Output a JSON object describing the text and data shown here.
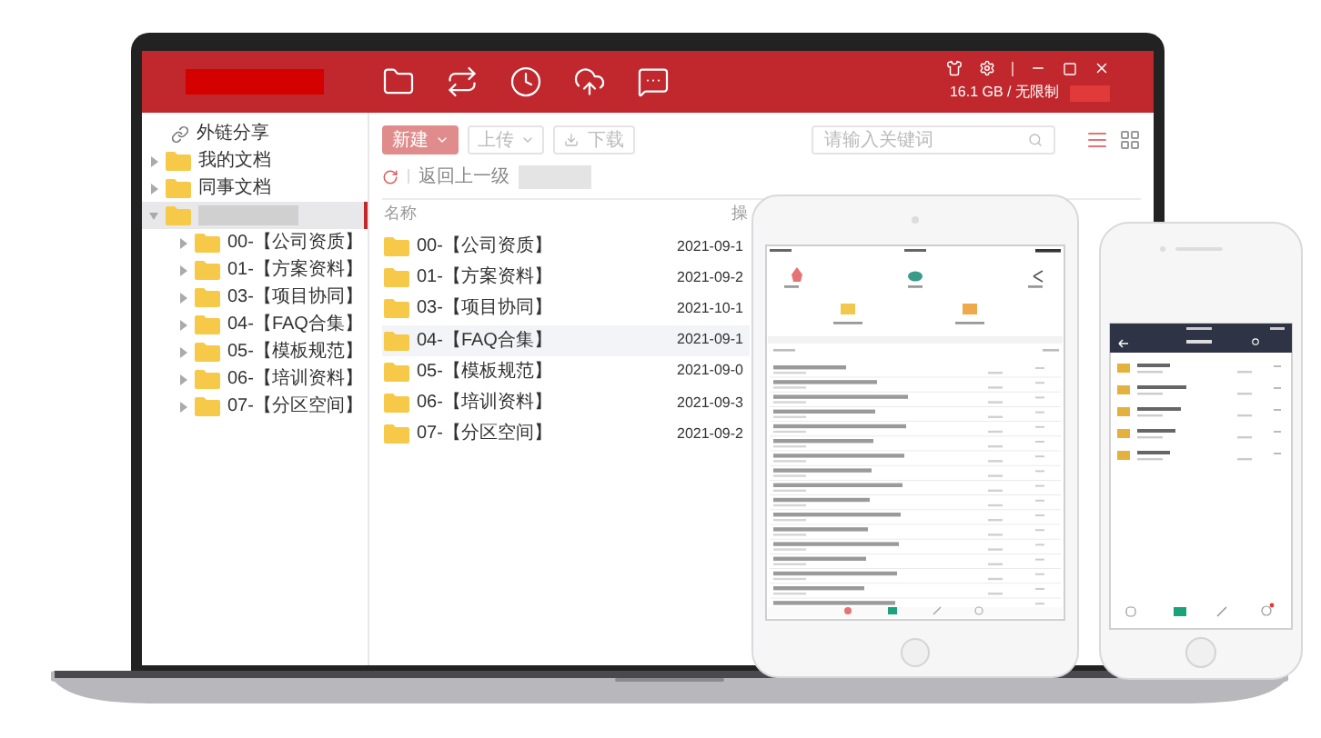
{
  "header": {
    "nav": [
      {
        "kind": "files"
      },
      {
        "kind": "sync"
      },
      {
        "kind": "recent"
      },
      {
        "kind": "transfer"
      },
      {
        "kind": "messages"
      }
    ],
    "storage": "16.1 GB / 无限制"
  },
  "sidebar": {
    "items": [
      {
        "kind": "link",
        "label": "外链分享"
      },
      {
        "kind": "folder",
        "label": "我的文档",
        "expanded": false,
        "selected": false
      },
      {
        "kind": "folder",
        "label": "同事文档",
        "expanded": false,
        "selected": false
      },
      {
        "kind": "redacted",
        "expanded": true,
        "selected": true,
        "children": [
          {
            "kind": "folder",
            "label": "00-【公司资质】",
            "expanded": false,
            "selected": false
          },
          {
            "kind": "folder",
            "label": "01-【方案资料】",
            "expanded": false,
            "selected": false
          },
          {
            "kind": "folder",
            "label": "03-【项目协同】",
            "expanded": false,
            "selected": false
          },
          {
            "kind": "folder",
            "label": "04-【FAQ合集】",
            "expanded": false,
            "selected": false
          },
          {
            "kind": "folder",
            "label": "05-【模板规范】",
            "expanded": false,
            "selected": false
          },
          {
            "kind": "folder",
            "label": "06-【培训资料】",
            "expanded": false,
            "selected": false
          },
          {
            "kind": "folder",
            "label": "07-【分区空间】",
            "expanded": false,
            "selected": false
          }
        ]
      }
    ]
  },
  "toolbar": {
    "buttons": [
      {
        "kind": "primary",
        "label": "新建"
      },
      {
        "kind": "dropdown",
        "label": "上传"
      },
      {
        "kind": "download",
        "label": "下载"
      }
    ],
    "search": {
      "placeholder": "请输入关键词"
    },
    "views": [
      {
        "kind": "list",
        "selected": true
      },
      {
        "kind": "grid",
        "selected": false
      }
    ]
  },
  "breadcrumb": {
    "back": "返回上一级"
  },
  "table": {
    "columns": [
      "名称",
      "操"
    ],
    "rows": [
      {
        "name": "00-【公司资质】",
        "date": "2021-09-1",
        "hovered": false
      },
      {
        "name": "01-【方案资料】",
        "date": "2021-09-2",
        "hovered": false
      },
      {
        "name": "03-【项目协同】",
        "date": "2021-10-1",
        "hovered": false
      },
      {
        "name": "04-【FAQ合集】",
        "date": "2021-09-1",
        "hovered": true
      },
      {
        "name": "05-【模板规范】",
        "date": "2021-09-0",
        "hovered": false
      },
      {
        "name": "06-【培训资料】",
        "date": "2021-09-3",
        "hovered": false
      },
      {
        "name": "07-【分区空间】",
        "date": "2021-09-2",
        "hovered": false
      }
    ]
  }
}
